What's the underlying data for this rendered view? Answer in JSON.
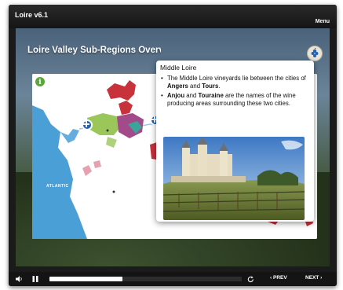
{
  "app": {
    "title": "Loire v6.1",
    "menu_label": "Menu"
  },
  "slide": {
    "title": "Loire Valley Sub-Regions Overview",
    "map": {
      "sea_label": "ATLANTIC"
    }
  },
  "popup": {
    "title": "Middle Loire",
    "bullets": [
      [
        {
          "text": "The Middle Loire vineyards lie between the cities of ",
          "bold": false
        },
        {
          "text": "Angers",
          "bold": true
        },
        {
          "text": " and ",
          "bold": false
        },
        {
          "text": "Tours",
          "bold": true
        },
        {
          "text": ".",
          "bold": false
        }
      ],
      [
        {
          "text": "Anjou",
          "bold": true
        },
        {
          "text": " and ",
          "bold": false
        },
        {
          "text": "Touraine",
          "bold": true
        },
        {
          "text": " are the names of the wine producing areas surrounding these two cities.",
          "bold": false
        }
      ]
    ]
  },
  "player": {
    "progress_fraction": 0.38,
    "prev_label": "PREV",
    "next_label": "NEXT"
  },
  "colors": {
    "sea": "#4a9fd6",
    "land": "#ffffff",
    "region_purple": "#a34b8a",
    "region_red": "#c8323b",
    "region_green": "#9ac65a",
    "region_teal": "#3aa49a",
    "accent_blue": "#1f63b5",
    "info_green": "#5aa83a"
  },
  "icons": [
    "info-icon",
    "plus-icon",
    "grape-icon",
    "volume-icon",
    "pause-icon",
    "replay-icon",
    "chevron-left-icon",
    "chevron-right-icon"
  ]
}
